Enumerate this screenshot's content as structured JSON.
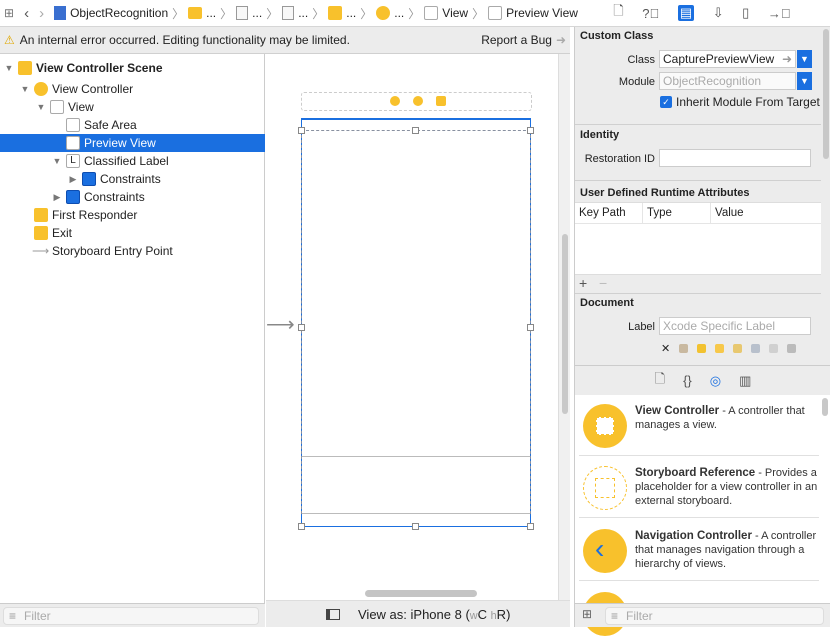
{
  "breadcrumb": {
    "project": "ObjectRecognition",
    "ellipsis": "...",
    "view": "View",
    "preview_view": "Preview View"
  },
  "inspector_tabs": [
    "file-icon",
    "help-icon",
    "identity-icon",
    "attributes-icon",
    "size-icon",
    "connections-icon"
  ],
  "warning": {
    "message": "An internal error occurred. Editing functionality may be limited.",
    "report": "Report a Bug"
  },
  "outline": {
    "items": [
      {
        "label": "View Controller Scene",
        "bold": true
      },
      {
        "label": "View Controller"
      },
      {
        "label": "View"
      },
      {
        "label": "Safe Area"
      },
      {
        "label": "Preview View",
        "selected": true
      },
      {
        "label": "Classified Label"
      },
      {
        "label": "Constraints"
      },
      {
        "label": "Constraints"
      },
      {
        "label": "First Responder"
      },
      {
        "label": "Exit"
      },
      {
        "label": "Storyboard Entry Point"
      }
    ],
    "filter_placeholder": "Filter"
  },
  "canvas": {
    "view_as": "View as: iPhone 8",
    "size_class_w": "w",
    "size_class_wv": "C",
    "size_class_h": "h",
    "size_class_hv": "R"
  },
  "identity": {
    "custom_class_title": "Custom Class",
    "class_label": "Class",
    "class_value": "CapturePreviewView",
    "module_label": "Module",
    "module_placeholder": "ObjectRecognition",
    "inherit_label": "Inherit Module From Target",
    "inherit_checked": true,
    "identity_title": "Identity",
    "restoration_label": "Restoration ID",
    "restoration_value": "",
    "udra_title": "User Defined Runtime Attributes",
    "columns": [
      "Key Path",
      "Type",
      "Value"
    ],
    "add": "+",
    "remove": "−",
    "document_title": "Document",
    "doc_label": "Label",
    "doc_placeholder": "Xcode Specific Label",
    "clear": "✕"
  },
  "library": {
    "tabs": [
      "file-icon",
      "braces-icon",
      "object-icon",
      "media-icon"
    ],
    "items": [
      {
        "title": "View Controller",
        "desc": " - A controller that manages a view."
      },
      {
        "title": "Storyboard Reference",
        "desc": " - Provides a placeholder for a view controller in an external storyboard."
      },
      {
        "title": "Navigation Controller",
        "desc": " - A controller that manages navigation through a hierarchy of views."
      }
    ],
    "filter_placeholder": "Filter"
  },
  "colors": {
    "accent": "#1a6fe0",
    "yellow": "#f8c12c"
  }
}
